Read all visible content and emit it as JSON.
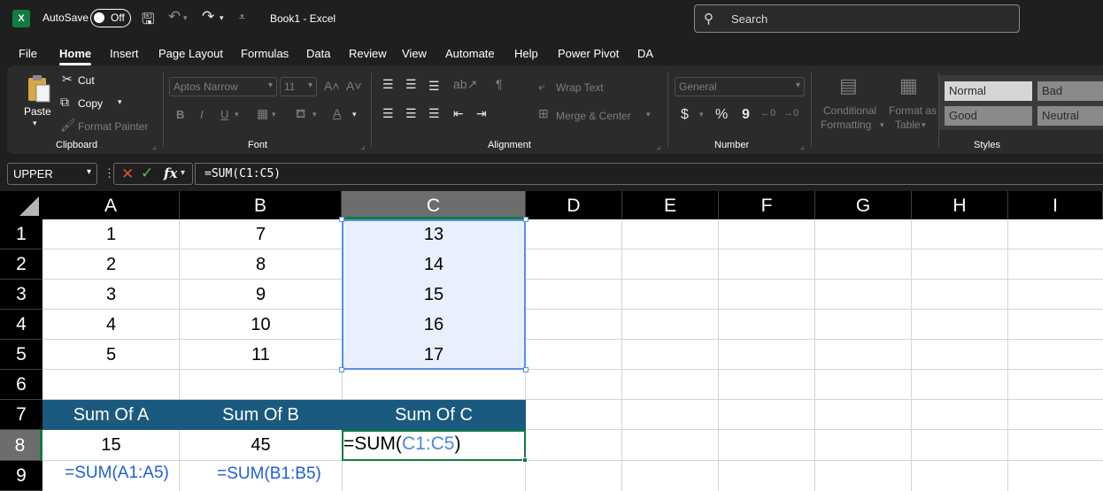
{
  "titlebar": {
    "logo": "X",
    "autosave_label": "AutoSave",
    "toggle_state": "Off",
    "doc_title": "Book1  -  Excel",
    "search_placeholder": "Search",
    "icons": [
      "save-icon",
      "undo-icon",
      "redo-icon",
      "customize-quick-access-icon"
    ]
  },
  "menu": {
    "tabs": [
      "File",
      "Home",
      "Insert",
      "Page Layout",
      "Formulas",
      "Data",
      "Review",
      "View",
      "Automate",
      "Help",
      "Power Pivot",
      "DA"
    ],
    "active": "Home"
  },
  "ribbon": {
    "clipboard": {
      "paste": "Paste",
      "cut": "Cut",
      "copy": "Copy",
      "format_painter": "Format Painter",
      "label": "Clipboard"
    },
    "font": {
      "font_name": "Aptos Narrow",
      "font_size": "11",
      "bold": "B",
      "italic": "I",
      "underline": "U",
      "label": "Font"
    },
    "alignment": {
      "wrap_text": "Wrap Text",
      "merge_center": "Merge & Center",
      "label": "Alignment"
    },
    "number": {
      "format": "General",
      "currency": "$",
      "percent": "%",
      "comma": "9",
      "label": "Number"
    },
    "styles": {
      "conditional": [
        "Conditional",
        "Formatting"
      ],
      "format_as_table": [
        "Format as",
        "Table"
      ],
      "cells": [
        {
          "label": "Normal",
          "bg": "#ffffff",
          "fg": "#000000"
        },
        {
          "label": "Bad",
          "bg": "#ffc7ce",
          "fg": "#9c0006"
        },
        {
          "label": "Good",
          "bg": "#c6efce",
          "fg": "#006100"
        },
        {
          "label": "Neutral",
          "bg": "#ffeb9c",
          "fg": "#9c5700"
        }
      ],
      "label": "Styles"
    }
  },
  "formula_bar": {
    "name_box": "UPPER",
    "fx": "fx",
    "formula": "=SUM(C1:C5)"
  },
  "sheet": {
    "columns": [
      "A",
      "B",
      "C",
      "D",
      "E",
      "F",
      "G",
      "H",
      "I"
    ],
    "rows": [
      "1",
      "2",
      "3",
      "4",
      "5",
      "6",
      "7",
      "8",
      "9"
    ],
    "data": {
      "A": [
        "1",
        "2",
        "3",
        "4",
        "5"
      ],
      "B": [
        "7",
        "8",
        "9",
        "10",
        "11"
      ],
      "C": [
        "13",
        "14",
        "15",
        "16",
        "17"
      ]
    },
    "summary_headers": [
      "Sum Of A",
      "Sum Of B",
      "Sum Of C"
    ],
    "summary_values": {
      "A8": "15",
      "B8": "45"
    },
    "editing_formula": {
      "prefix": "=SUM(",
      "ref": "C1:C5",
      "suffix": ")"
    },
    "notes": {
      "A9": "=SUM(A1:A5)",
      "B9": "=SUM(B1:B5)"
    },
    "colors": {
      "header_fill": "#1a5a7e",
      "selection": "#e8f0fd",
      "accent": "#107c41",
      "note": "#1f5fd6"
    }
  }
}
